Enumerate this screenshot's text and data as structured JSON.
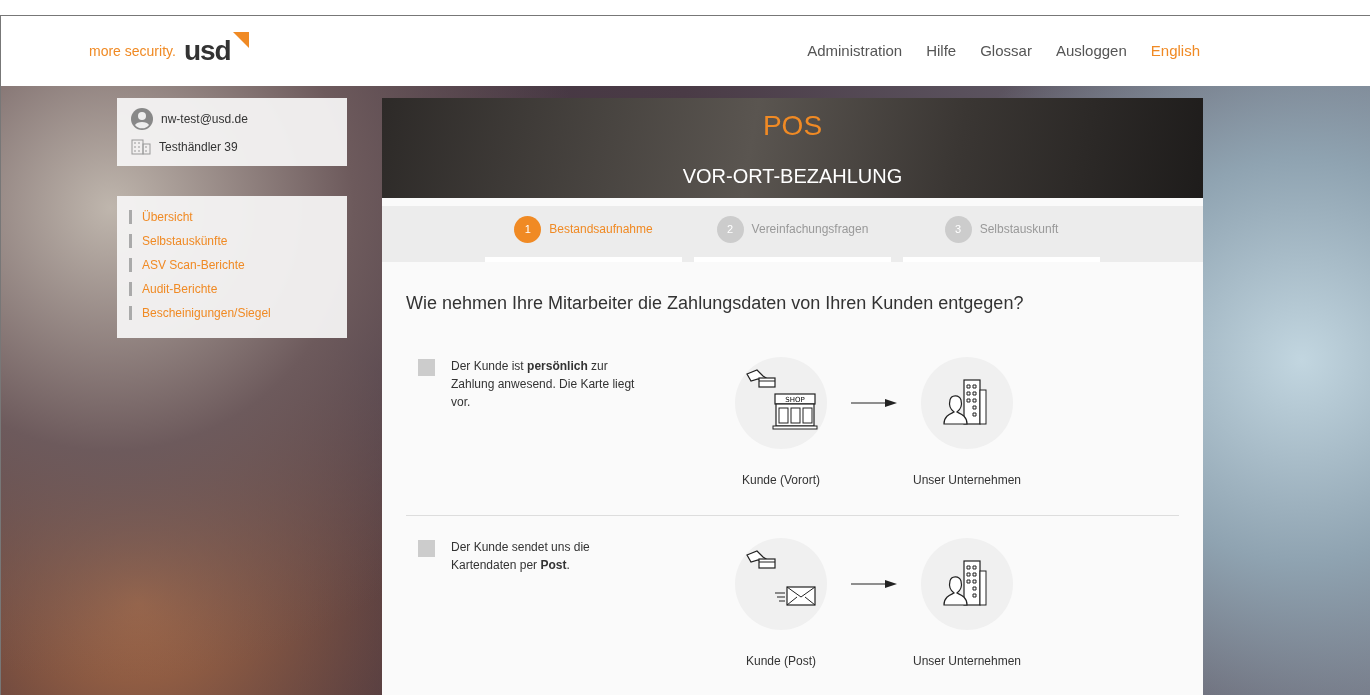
{
  "logo": {
    "tagline": "more security.",
    "brand": "usd"
  },
  "nav": [
    {
      "label": "Administration",
      "kind": "link"
    },
    {
      "label": "Hilfe",
      "kind": "link"
    },
    {
      "label": "Glossar",
      "kind": "link"
    },
    {
      "label": "Ausloggen",
      "kind": "link"
    },
    {
      "label": "English",
      "kind": "language"
    }
  ],
  "user": {
    "email": "nw-test@usd.de",
    "company": "Testhändler 39"
  },
  "sidebar": {
    "items": [
      {
        "label": "Übersicht"
      },
      {
        "label": "Selbstauskünfte"
      },
      {
        "label": "ASV Scan-Berichte"
      },
      {
        "label": "Audit-Berichte"
      },
      {
        "label": "Bescheinigungen/Siegel"
      }
    ]
  },
  "hero": {
    "title": "POS",
    "subtitle": "VOR-ORT-BEZAHLUNG"
  },
  "steps": [
    {
      "number": "1",
      "label": "Bestandsaufnahme",
      "selected": true
    },
    {
      "number": "2",
      "label": "Vereinfachungsfragen",
      "selected": false
    },
    {
      "number": "3",
      "label": "Selbstauskunft",
      "selected": false
    }
  ],
  "question": "Wie nehmen Ihre Mitarbeiter die Zahlungsdaten von Ihren Kunden entgegen?",
  "options": [
    {
      "text": "Der Kunde ist **persönlich** zur Zahlung anwesend. Die Karte liegt vor.",
      "checked": false,
      "kind": "shop",
      "sign": "SHOP",
      "from_label": "Kunde (Vorort)",
      "to_label": "Unser Unternehmen"
    },
    {
      "text": "Der Kunde sendet uns die Kartendaten per **Post**.",
      "checked": false,
      "kind": "mail",
      "from_label": "Kunde (Post)",
      "to_label": "Unser Unternehmen"
    }
  ]
}
